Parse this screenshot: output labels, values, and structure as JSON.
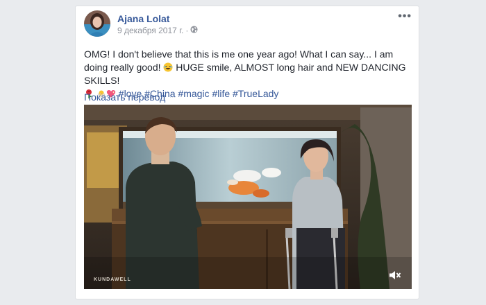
{
  "post": {
    "author": "Ajana Lolat",
    "date": "9 декабря 2017 г.",
    "separator": "·",
    "privacy_icon": "globe-icon",
    "more_icon": "more-options-icon",
    "more_label": "•••",
    "text_1": "OMG! I don't believe that this is me one year ago! What I can say... I am doing really good! ",
    "text_2": " HUGE smile, ALMOST long hair and NEW DANCING SKILLS!",
    "emojis": [
      "laughing-emoji",
      "rose-emoji",
      "baby-chick-emoji",
      "sparkling-heart-emoji"
    ],
    "hashtags": [
      "#love",
      "#China",
      "#magic",
      "#life",
      "#TrueLady"
    ],
    "translate_label": "Показать перевод"
  },
  "video": {
    "watermark": "KUNDAWELL",
    "mute_icon": "mute-icon"
  },
  "colors": {
    "link": "#365899",
    "text": "#1d2129",
    "meta": "#90949c",
    "background": "#e9ebee"
  }
}
